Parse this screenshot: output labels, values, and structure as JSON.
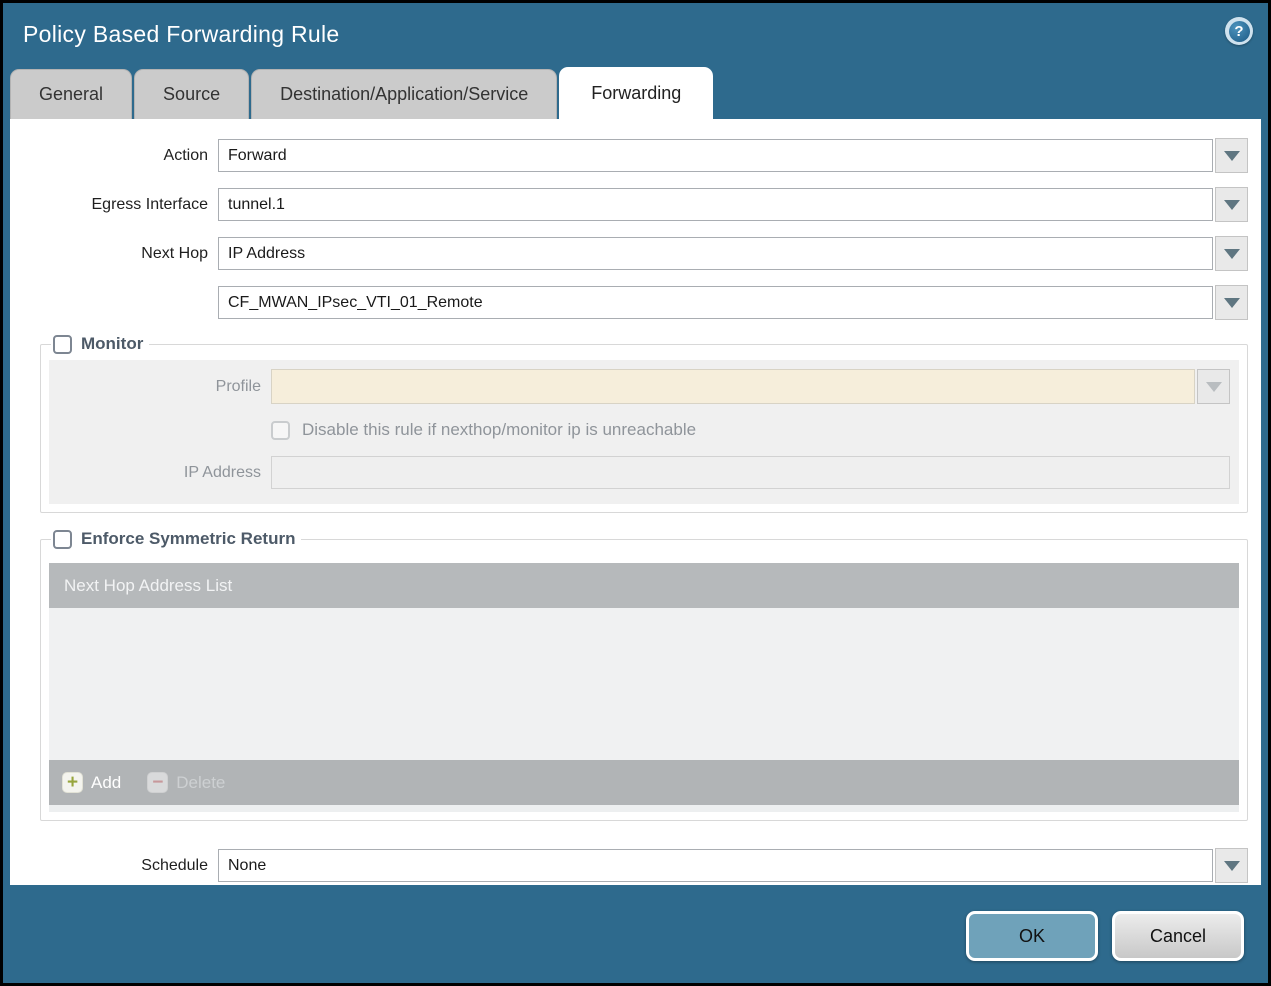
{
  "window": {
    "title": "Policy Based Forwarding Rule"
  },
  "icons": {
    "help": "?",
    "add": "+",
    "delete": "−"
  },
  "tabs": [
    {
      "label": "General"
    },
    {
      "label": "Source"
    },
    {
      "label": "Destination/Application/Service"
    },
    {
      "label": "Forwarding"
    }
  ],
  "form": {
    "action": {
      "label": "Action",
      "value": "Forward"
    },
    "egress_interface": {
      "label": "Egress Interface",
      "value": "tunnel.1"
    },
    "next_hop": {
      "label": "Next Hop",
      "value": "IP Address"
    },
    "next_hop_address": {
      "value": "CF_MWAN_IPsec_VTI_01_Remote"
    },
    "schedule": {
      "label": "Schedule",
      "value": "None"
    }
  },
  "monitor": {
    "legend": "Monitor",
    "checked": false,
    "profile": {
      "label": "Profile",
      "value": ""
    },
    "disable_rule": {
      "label": "Disable this rule if nexthop/monitor ip is unreachable",
      "checked": false
    },
    "ip_address": {
      "label": "IP Address",
      "value": ""
    }
  },
  "enforce_symmetric_return": {
    "legend": "Enforce Symmetric Return",
    "checked": false,
    "table": {
      "header": "Next Hop Address List",
      "rows": []
    },
    "add_label": "Add",
    "delete_label": "Delete"
  },
  "footer": {
    "ok_label": "OK",
    "cancel_label": "Cancel"
  },
  "colors": {
    "frame_teal": "#2e6a8d",
    "ok_button": "#6fa2ba",
    "disabled_input_beige": "#f6eedb",
    "legend_text": "#4d5a68",
    "grid_header": "#b6b9bb"
  }
}
